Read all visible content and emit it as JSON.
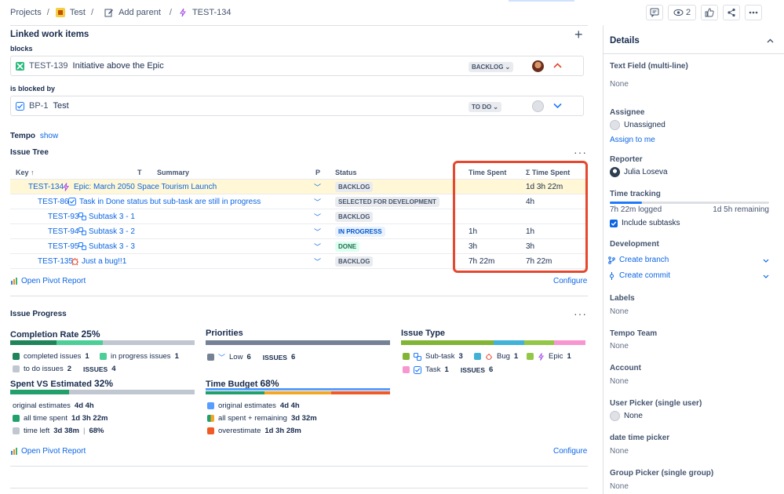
{
  "breadcrumb": {
    "projects": "Projects",
    "test": "Test",
    "add_parent": "Add parent",
    "current_key": "TEST-134"
  },
  "top_actions": {
    "watch_count": "2"
  },
  "linked": {
    "title": "Linked work items",
    "blocks_label": "blocks",
    "blocks_item": {
      "key": "TEST-139",
      "summary": "Initiative above the Epic",
      "status": "BACKLOG"
    },
    "blocked_by_label": "is blocked by",
    "blocked_by_item": {
      "key": "BP-1",
      "summary": "Test",
      "status": "TO DO"
    }
  },
  "tempo": {
    "label": "Tempo",
    "show": "show"
  },
  "issue_tree": {
    "title": "Issue Tree",
    "columns": {
      "key": "Key",
      "t": "T",
      "summary": "Summary",
      "p": "P",
      "status": "Status",
      "time_spent": "Time Spent",
      "sum_time_spent": "Σ Time Spent"
    },
    "rows": [
      {
        "key": "TEST-134",
        "summary": "Epic: March 2050 Space Tourism Launch",
        "status": "BACKLOG",
        "time_spent": "",
        "sum_time": "1d 3h 22m"
      },
      {
        "key": "TEST-86",
        "summary": "Task in Done status but sub-task are still in progress",
        "status": "SELECTED FOR DEVELOPMENT",
        "time_spent": "",
        "sum_time": "4h"
      },
      {
        "key": "TEST-93",
        "summary": "Subtask 3 - 1",
        "status": "BACKLOG",
        "time_spent": "",
        "sum_time": ""
      },
      {
        "key": "TEST-94",
        "summary": "Subtask 3 - 2",
        "status": "IN PROGRESS",
        "time_spent": "1h",
        "sum_time": "1h"
      },
      {
        "key": "TEST-95",
        "summary": "Subtask 3 - 3",
        "status": "DONE",
        "time_spent": "3h",
        "sum_time": "3h"
      },
      {
        "key": "TEST-135",
        "summary": "Just a bug!!1",
        "status": "BACKLOG",
        "time_spent": "7h 22m",
        "sum_time": "7h 22m"
      }
    ],
    "open_pivot": "Open Pivot Report",
    "configure": "Configure"
  },
  "progress": {
    "title": "Issue Progress",
    "completion": {
      "label": "Completion Rate",
      "pct": "25%",
      "completed": "completed issues",
      "completed_n": "1",
      "in_progress": "in progress issues",
      "in_progress_n": "1",
      "todo": "to do issues",
      "todo_n": "2",
      "issues_lbl": "ISSUES",
      "issues_n": "4"
    },
    "priorities": {
      "label": "Priorities",
      "low": "Low",
      "low_n": "6",
      "issues_lbl": "ISSUES",
      "issues_n": "6"
    },
    "issue_type": {
      "label": "Issue Type",
      "subtask": "Sub-task",
      "subtask_n": "3",
      "bug": "Bug",
      "bug_n": "1",
      "epic": "Epic",
      "epic_n": "1",
      "task": "Task",
      "task_n": "1",
      "issues_lbl": "ISSUES",
      "issues_n": "6"
    },
    "spent": {
      "label": "Spent VS Estimated",
      "pct": "32%",
      "orig": "original estimates",
      "orig_v": "4d 4h",
      "all_spent": "all time spent",
      "all_spent_v": "1d 3h 22m",
      "left": "time left",
      "left_v": "3d 38m",
      "left_pct": "68%"
    },
    "budget": {
      "label": "Time Budget",
      "pct": "68%",
      "orig": "original estimates",
      "orig_v": "4d 4h",
      "all": "all spent + remaining",
      "all_v": "3d 32m",
      "over": "overestimate",
      "over_v": "1d 3h 28m"
    },
    "open_pivot": "Open Pivot Report",
    "configure": "Configure"
  },
  "sidebar": {
    "title": "Details",
    "text_field_label": "Text Field (multi-line)",
    "text_field_val": "None",
    "assignee_label": "Assignee",
    "assignee_val": "Unassigned",
    "assign_to_me": "Assign to me",
    "reporter_label": "Reporter",
    "reporter_val": "Julia Loseva",
    "time_tracking_label": "Time tracking",
    "logged": "7h 22m logged",
    "remaining": "1d 5h remaining",
    "include_subtasks": "Include subtasks",
    "development_label": "Development",
    "create_branch": "Create branch",
    "create_commit": "Create commit",
    "labels_label": "Labels",
    "labels_val": "None",
    "tempo_team_label": "Tempo Team",
    "tempo_team_val": "None",
    "account_label": "Account",
    "account_val": "None",
    "user_picker_label": "User Picker (single user)",
    "user_picker_val": "None",
    "date_picker_label": "date time picker",
    "date_picker_val": "None",
    "group_picker_label": "Group Picker (single group)",
    "group_picker_val": "None"
  },
  "colors": {
    "accent": "#0c66e4",
    "highlight_box": "#e5482e",
    "row_highlight": "#fff7d6"
  }
}
